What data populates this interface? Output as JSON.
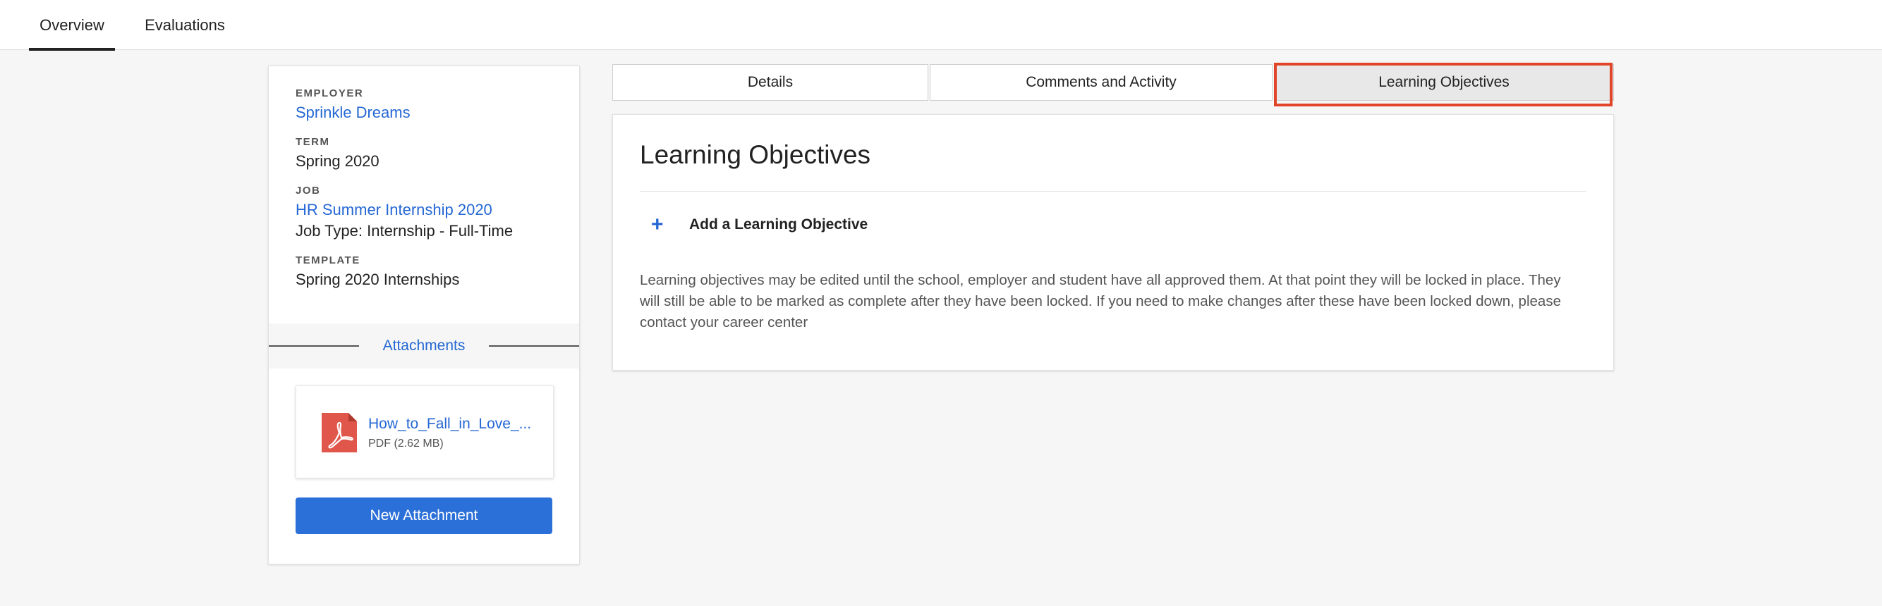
{
  "topnav": {
    "tabs": [
      {
        "label": "Overview",
        "active": true
      },
      {
        "label": "Evaluations",
        "active": false
      }
    ]
  },
  "summary": {
    "employer_label": "EMPLOYER",
    "employer": "Sprinkle Dreams",
    "term_label": "TERM",
    "term": "Spring 2020",
    "job_label": "JOB",
    "job": "HR Summer Internship 2020",
    "job_type": "Job Type: Internship - Full-Time",
    "template_label": "TEMPLATE",
    "template": "Spring 2020 Internships"
  },
  "attachments": {
    "heading": "Attachments",
    "files": [
      {
        "name": "How_to_Fall_in_Love_...",
        "meta": "PDF (2.62 MB)",
        "icon": "pdf-file-icon"
      }
    ],
    "new_button": "New Attachment"
  },
  "subtabs": [
    {
      "label": "Details",
      "active": false
    },
    {
      "label": "Comments and Activity",
      "active": false
    },
    {
      "label": "Learning Objectives",
      "active": true
    }
  ],
  "main": {
    "title": "Learning Objectives",
    "add_label": "Add a Learning Objective",
    "plus_glyph": "+",
    "note": "Learning objectives may be edited until the school, employer and student have all approved them. At that point they will be locked in place. They will still be able to be marked as complete after they have been locked. If you need to make changes after these have been locked down, please contact your career center"
  },
  "colors": {
    "accent": "#2467d4",
    "button": "#2b6fd8",
    "highlight": "#e0452a",
    "pdf": "#e0564a"
  }
}
